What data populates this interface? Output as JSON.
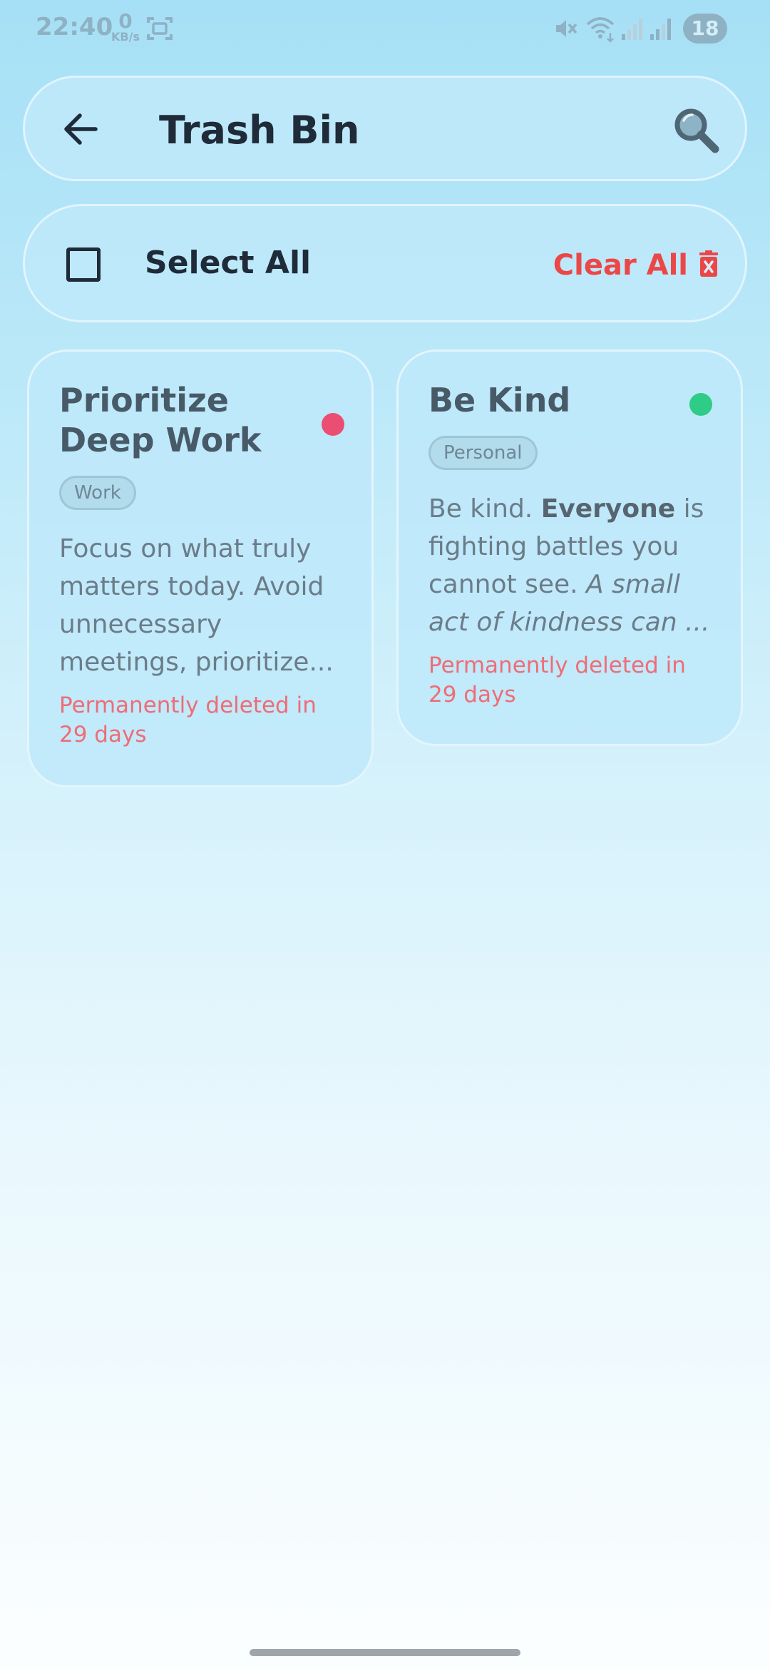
{
  "status_bar": {
    "time": "22:40",
    "speed_value": "0",
    "speed_unit": "KB/s",
    "battery": "18"
  },
  "header": {
    "title": "Trash Bin",
    "back_icon": "arrow-left-icon",
    "search_icon": "search-icon"
  },
  "action_bar": {
    "select_all_label": "Select All",
    "clear_all_label": "Clear All",
    "clear_icon": "trash-icon",
    "clear_color": "#ec4747"
  },
  "notes": [
    {
      "title": "Prioritize Deep Work",
      "tag": "Work",
      "dot_color": "#ea4e73",
      "body_segments": [
        {
          "text": "Focus on what truly matters today. Avoid unnecessary meetings, prioritize...",
          "style": "normal"
        }
      ],
      "expiry": "Permanently deleted in 29 days"
    },
    {
      "title": "Be Kind",
      "tag": "Personal",
      "dot_color": "#2ecc86",
      "body_segments": [
        {
          "text": "Be kind. ",
          "style": "normal"
        },
        {
          "text": "Everyone",
          "style": "bold"
        },
        {
          "text": " is fighting battles you cannot see. ",
          "style": "normal"
        },
        {
          "text": "A small act of kindness can ...",
          "style": "italic"
        }
      ],
      "expiry": "Permanently deleted in 29 days"
    }
  ]
}
